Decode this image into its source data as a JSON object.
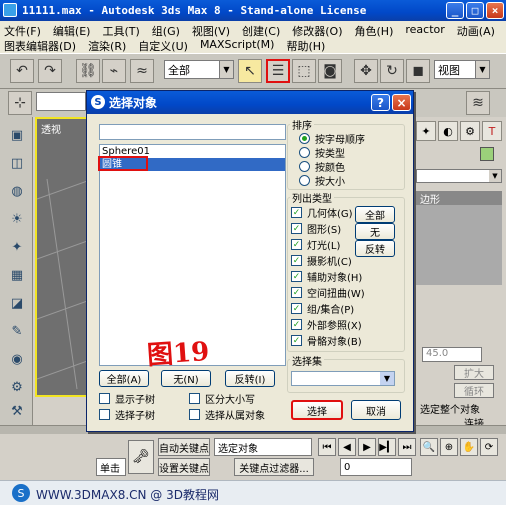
{
  "window": {
    "title": "11111.max - Autodesk 3ds Max 8  - Stand-alone License",
    "min_label": "_",
    "max_label": "□",
    "close_label": "×"
  },
  "menu": {
    "row1": [
      "文件(F)",
      "编辑(E)",
      "工具(T)",
      "组(G)",
      "视图(V)",
      "创建(C)",
      "修改器(O)",
      "角色(H)",
      "reactor",
      "动画(A)"
    ],
    "row2": [
      "图表编辑器(D)",
      "渲染(R)",
      "自定义(U)",
      "MAXScript(M)",
      "帮助(H)"
    ]
  },
  "toolbar": {
    "filter_select": "全部",
    "view_select": "视图"
  },
  "viewport": {
    "label": "透视"
  },
  "right_panel": {
    "edge_label": "边形",
    "value": "45.0",
    "expand": "扩大",
    "loop": "循环",
    "select_whole": "选定整个对象",
    "connect": "连接"
  },
  "bottom": {
    "auto_key": "自动关键点",
    "set_key": "设置关键点",
    "selected_object": "选定对象",
    "key_filter": "关键点过滤器...",
    "frame": "0",
    "click": "单击"
  },
  "footer": {
    "text": "WWW.3DMAX8.CN @ 3D教程网",
    "logo": "S"
  },
  "dialog": {
    "title": "选择对象",
    "help_label": "?",
    "close_label": "×",
    "list_items": [
      "Sphere01",
      "圆锥"
    ],
    "selected_item": "圆锥",
    "buttons": {
      "all": "全部(A)",
      "none": "无(N)",
      "invert": "反转(I)",
      "select": "选择",
      "cancel": "取消"
    },
    "checks": {
      "show_children": "显示子树",
      "case_sensitive": "区分大小写",
      "select_children": "选择子树",
      "select_dependents": "选择从属对象"
    },
    "sort": {
      "label": "排序",
      "options": [
        "按字母顺序",
        "按类型",
        "按颜色",
        "按大小"
      ],
      "selected": 0
    },
    "list_types": {
      "label": "列出类型",
      "items": [
        "几何体(G)",
        "图形(S)",
        "灯光(L)",
        "摄影机(C)",
        "辅助对象(H)",
        "空间扭曲(W)",
        "组/集合(P)",
        "外部参照(X)",
        "骨骼对象(B)"
      ],
      "all": "全部",
      "none": "无",
      "invert": "反转"
    },
    "selection_set": {
      "label": "选择集"
    },
    "annotation": "图19"
  }
}
